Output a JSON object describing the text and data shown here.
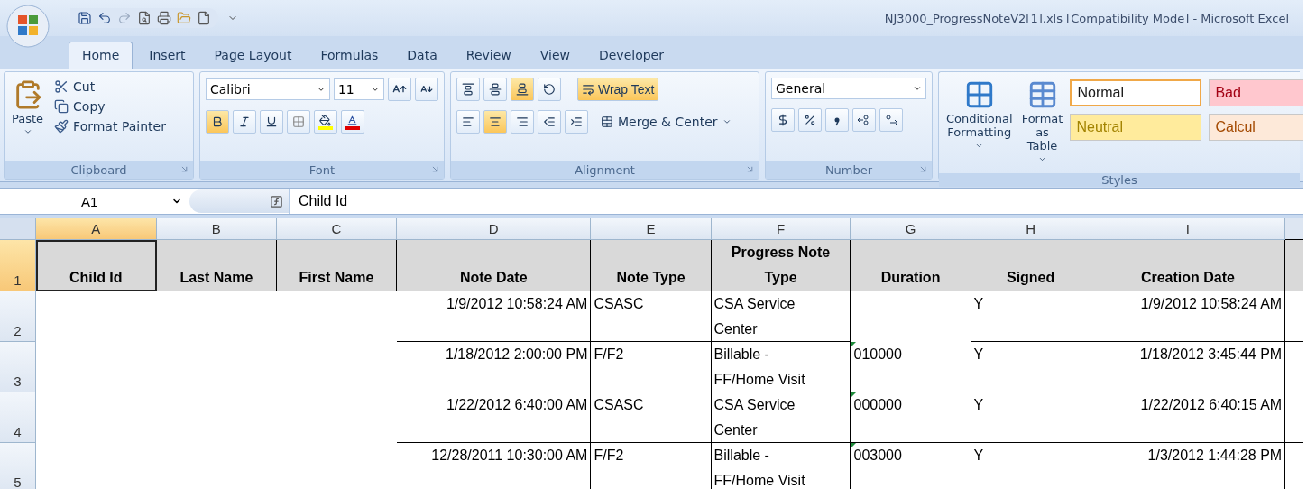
{
  "window": {
    "title": "NJ3000_ProgressNoteV2[1].xls  [Compatibility Mode] - Microsoft Excel"
  },
  "tabs": [
    {
      "label": "Home",
      "selected": true
    },
    {
      "label": "Insert",
      "selected": false
    },
    {
      "label": "Page Layout",
      "selected": false
    },
    {
      "label": "Formulas",
      "selected": false
    },
    {
      "label": "Data",
      "selected": false
    },
    {
      "label": "Review",
      "selected": false
    },
    {
      "label": "View",
      "selected": false
    },
    {
      "label": "Developer",
      "selected": false
    }
  ],
  "ribbon": {
    "clipboard": {
      "label": "Clipboard",
      "paste": "Paste",
      "items": [
        "Cut",
        "Copy",
        "Format Painter"
      ]
    },
    "font": {
      "label": "Font",
      "font_name": "Calibri",
      "font_size": "11",
      "bold": true,
      "italic": false,
      "underline": false
    },
    "alignment": {
      "label": "Alignment",
      "vertical_buttons": [
        {
          "selected": false
        },
        {
          "selected": false
        },
        {
          "selected": true
        }
      ],
      "horizontal_buttons": [
        {
          "selected": false
        },
        {
          "selected": true
        },
        {
          "selected": false
        }
      ],
      "wrap_text": {
        "label": "Wrap Text",
        "on": true
      },
      "merge": "Merge & Center"
    },
    "number": {
      "label": "Number",
      "format": "General"
    },
    "styles": {
      "label": "Styles",
      "conditional_formatting": "Conditional Formatting",
      "format_as_table": "Format as Table",
      "cells": [
        {
          "label": "Normal",
          "color": "#ffffff",
          "selected": true
        },
        {
          "label": "Bad",
          "color": "#ffc7ce",
          "selected": false
        },
        {
          "label": "Neutral",
          "color": "#ffeb9c",
          "selected": false
        },
        {
          "label": "Calcul",
          "color": "#fde9d9",
          "selected": false
        }
      ]
    }
  },
  "formula_bar": {
    "name_box": "A1",
    "formula": "Child Id"
  },
  "sheet": {
    "columns": [
      {
        "letter": "A",
        "selected": true
      },
      {
        "letter": "B",
        "selected": false
      },
      {
        "letter": "C",
        "selected": false
      },
      {
        "letter": "D",
        "selected": false
      },
      {
        "letter": "E",
        "selected": false
      },
      {
        "letter": "F",
        "selected": false
      },
      {
        "letter": "G",
        "selected": false
      },
      {
        "letter": "H",
        "selected": false
      },
      {
        "letter": "I",
        "selected": false
      }
    ],
    "rows": [
      {
        "number": "1",
        "selected": true,
        "kind": "header",
        "duration_flag": false,
        "cells": [
          "Child Id",
          "Last Name",
          "First Name",
          "Note Date",
          "Note Type",
          "Progress Note Type",
          "Duration",
          "Signed",
          "Creation Date"
        ]
      },
      {
        "number": "2",
        "selected": false,
        "kind": "data",
        "duration_flag": false,
        "cells": [
          null,
          null,
          null,
          "1/9/2012 10:58:24 AM",
          "CSASC",
          "CSA Service Center",
          null,
          "Y",
          "1/9/2012 10:58:24 AM"
        ]
      },
      {
        "number": "3",
        "selected": false,
        "kind": "data",
        "duration_flag": true,
        "cells": [
          null,
          null,
          null,
          "1/18/2012 2:00:00 PM",
          "F/F2",
          "Billable - FF/Home Visit",
          "010000",
          "Y",
          "1/18/2012 3:45:44 PM"
        ]
      },
      {
        "number": "4",
        "selected": false,
        "kind": "data",
        "duration_flag": true,
        "cells": [
          null,
          null,
          null,
          "1/22/2012 6:40:00 AM",
          "CSASC",
          "CSA Service Center",
          "000000",
          "Y",
          "1/22/2012 6:40:15 AM"
        ]
      },
      {
        "number": "5",
        "selected": false,
        "kind": "data",
        "duration_flag": true,
        "cells": [
          null,
          null,
          null,
          "12/28/2011 10:30:00 AM",
          "F/F2",
          "Billable - FF/Home Visit",
          "003000",
          "Y",
          "1/3/2012 1:44:28 PM"
        ]
      }
    ]
  }
}
